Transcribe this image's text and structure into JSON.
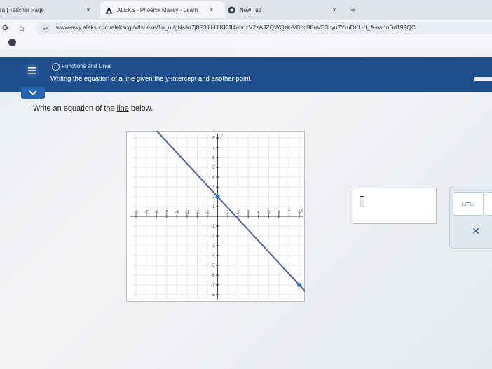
{
  "browser": {
    "tabs": [
      {
        "label": "ra | Teacher Page",
        "close": "×"
      },
      {
        "label": "ALEKS - Phoenix Maxey - Learn",
        "close": "×"
      },
      {
        "label": "New Tab",
        "close": "×"
      }
    ],
    "new_tab": "+",
    "url": "www-awy.aleks.com/alekscgi/x/Isl.exe/1o_u-lgNslkr7j8P3jH-lJlKKJI4ahozV2zAJZQWQzk-VBhd98uVE3Lyu7YruDXL-d_A-rwhoDd199QC"
  },
  "header": {
    "topic": "Functions and Lines",
    "subtitle": "Writing the equation of a line given the y-intercept and another point"
  },
  "problem": {
    "prompt_pre": "Write an equation of the ",
    "prompt_link": "line",
    "prompt_post": " below."
  },
  "graph": {
    "xlim": [
      -8,
      8
    ],
    "ylim": [
      -8,
      8
    ],
    "x_axis_label": "x",
    "y_axis_label": "y",
    "x_ticks": [
      -8,
      -7,
      -6,
      -5,
      -4,
      -3,
      -2,
      -1,
      1,
      2,
      3,
      4,
      5,
      6,
      7,
      8
    ],
    "y_ticks": [
      8,
      7,
      6,
      5,
      4,
      3,
      2,
      1,
      -1,
      -2,
      -3,
      -4,
      -5,
      -6,
      -7,
      -8
    ],
    "line_color": "#4a5f9e",
    "point_color": "#2d6fd0",
    "points": [
      [
        0,
        2
      ],
      [
        8,
        -7
      ]
    ]
  },
  "tools": {
    "equation_button": "□=□",
    "clear_button": "×"
  }
}
